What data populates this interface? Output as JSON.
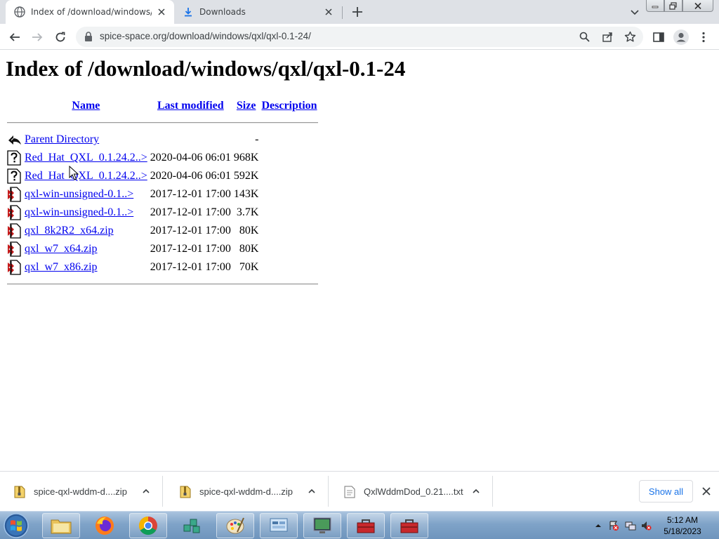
{
  "browser": {
    "tabs": [
      {
        "title": "Index of /download/windows/qx",
        "active": true
      },
      {
        "title": "Downloads",
        "active": false
      }
    ],
    "url": "spice-space.org/download/windows/qxl/qxl-0.1-24/"
  },
  "page": {
    "heading": "Index of /download/windows/qxl/qxl-0.1-24",
    "columns": {
      "name": "Name",
      "modified": "Last modified",
      "size": "Size",
      "description": "Description"
    },
    "parent": {
      "name": "Parent Directory",
      "size": "-"
    },
    "rows": [
      {
        "name": "Red_Hat_QXL_0.1.24.2..>",
        "modified": "2020-04-06 06:01",
        "size": "968K",
        "icon": "unknown-file-icon"
      },
      {
        "name": "Red_Hat_QXL_0.1.24.2..>",
        "modified": "2020-04-06 06:01",
        "size": "592K",
        "icon": "unknown-file-icon"
      },
      {
        "name": "qxl-win-unsigned-0.1..>",
        "modified": "2017-12-01 17:00",
        "size": "143K",
        "icon": "compressed-file-icon"
      },
      {
        "name": "qxl-win-unsigned-0.1..>",
        "modified": "2017-12-01 17:00",
        "size": "3.7K",
        "icon": "compressed-file-icon"
      },
      {
        "name": "qxl_8k2R2_x64.zip",
        "modified": "2017-12-01 17:00",
        "size": "80K",
        "icon": "compressed-file-icon"
      },
      {
        "name": "qxl_w7_x64.zip",
        "modified": "2017-12-01 17:00",
        "size": "80K",
        "icon": "compressed-file-icon"
      },
      {
        "name": "qxl_w7_x86.zip",
        "modified": "2017-12-01 17:00",
        "size": "70K",
        "icon": "compressed-file-icon"
      }
    ]
  },
  "downloads": {
    "items": [
      {
        "name": "spice-qxl-wddm-d....zip",
        "icon": "zip-file-icon"
      },
      {
        "name": "spice-qxl-wddm-d....zip",
        "icon": "zip-file-icon"
      },
      {
        "name": "QxlWddmDod_0.21....txt",
        "icon": "text-file-icon"
      }
    ],
    "show_all": "Show all"
  },
  "taskbar": {
    "time": "5:12 AM",
    "date": "5/18/2023"
  },
  "colors": {
    "link": "#0000ee",
    "accent": "#1a73e8",
    "tabstrip": "#dee1e6"
  }
}
